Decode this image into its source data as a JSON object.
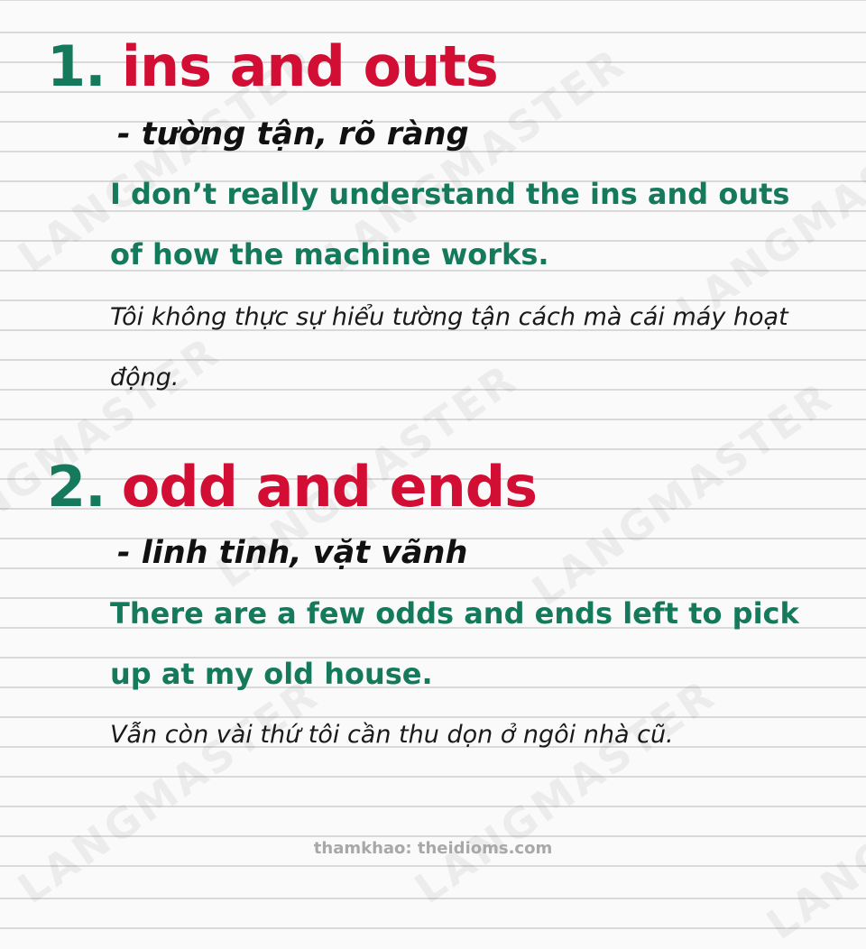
{
  "watermark": "LANGMASTER",
  "idioms": [
    {
      "number": "1.",
      "phrase": "ins and outs",
      "meaning": "- tường tận, rõ ràng",
      "example": "I don’t really understand the ins and outs of how the machine works.",
      "translation": "Tôi không thực sự hiểu tường tận cách mà cái máy hoạt động."
    },
    {
      "number": "2.",
      "phrase": "odd and ends",
      "meaning": "- linh tinh, vặt vãnh",
      "example": "There are a few odds and ends left to pick up at my old house.",
      "translation": "Vẫn còn vài thứ tôi cần thu dọn ở ngôi nhà cũ."
    }
  ],
  "footer": {
    "source": "thamkhao: theidioms.com"
  },
  "colors": {
    "number": "#157a5b",
    "phrase": "#d20e34",
    "example": "#157a5b",
    "text": "#111111",
    "footer": "#a8a8a8"
  }
}
